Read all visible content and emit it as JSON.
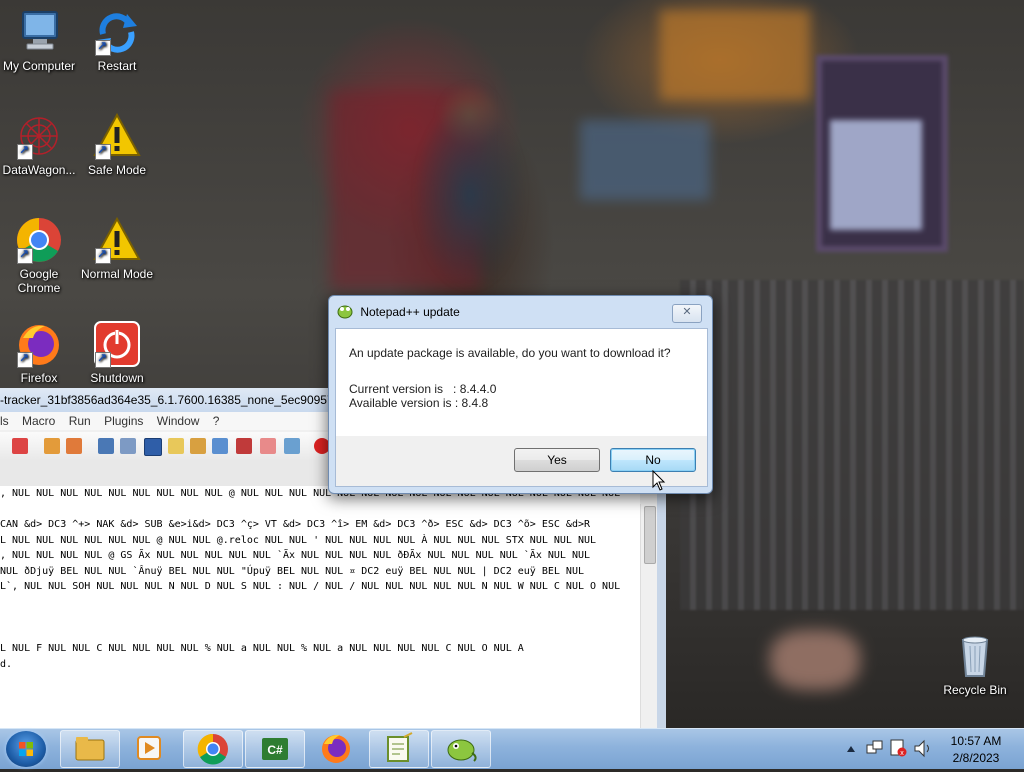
{
  "desktop": {
    "icons": [
      {
        "label": "My Computer"
      },
      {
        "label": "Restart"
      },
      {
        "label": "DataWagon..."
      },
      {
        "label": "Safe Mode"
      },
      {
        "label": "Google Chrome"
      },
      {
        "label": "Normal Mode"
      },
      {
        "label": "Firefox"
      },
      {
        "label": "Shutdown"
      },
      {
        "label": "Recycle Bin"
      }
    ]
  },
  "notepad": {
    "title": "-tracker_31bf3856ad364e35_6.1.7600.16385_none_5ec90957e1a8",
    "menu": [
      "ls",
      "Macro",
      "Run",
      "Plugins",
      "Window",
      "?"
    ],
    "editor_lines": [
      ", NUL NUL NUL NUL NUL NUL NUL NUL NUL @ NUL NUL NUL NUL NUL NUL NUL NUL NUL NUL NUL NUL NUL NUL NUL NUL",
      "",
      "CAN &d> DC3 ^+> NAK &d> SUB &e>i&d> DC3 ^ç> VT &d> DC3 ^î> EM &d> DC3 ^ð> ESC &d> DC3 ^õ> ESC &d>R",
      "L NUL NUL NUL NUL NUL NUL @ NUL NUL @.reloc NUL NUL ' NUL NUL NUL NUL À NUL NUL NUL STX NUL NUL NUL",
      ", NUL NUL NUL NUL @ GS Ãx NUL NUL NUL NUL NUL `Ãx NUL NUL NUL NUL ðÐÃx NUL NUL NUL NUL `Ãx NUL NUL",
      "  NUL ðDjuÿ BEL NUL NUL `Ânuÿ BEL NUL NUL \"Úpuÿ BEL NUL NUL ¤ DC2 euÿ BEL NUL NUL | DC2 euÿ BEL NUL",
      "L`, NUL NUL SOH NUL NUL NUL N NUL D NUL S NUL : NUL / NUL / NUL NUL NUL NUL NUL N NUL W NUL C NUL O NUL",
      "",
      "",
      "",
      "L NUL F NUL NUL C NUL NUL NUL   NUL % NUL a NUL   NUL % NUL a NUL   NUL NUL NUL C NUL O NUL A",
      "d."
    ]
  },
  "dialog": {
    "title": "Notepad++ update",
    "message": "An update package is available, do you want to download it?",
    "current_label": "Current version is",
    "current_value": ": 8.4.4.0",
    "available_label": "Available version is",
    "available_value": ": 8.4.8",
    "yes_label": "Yes",
    "no_label": "No",
    "close_glyph": "✕"
  },
  "taskbar": {
    "time": "10:57 AM",
    "date": "2/8/2023",
    "apps": [
      "explorer",
      "media-player",
      "chrome",
      "csharp-editor",
      "firefox",
      "notepad-plus-plus",
      "notepad-plus-plus-update"
    ]
  },
  "colors": {
    "taskbar": "#8db2dc",
    "dialog_frame": "#cfe0f4",
    "button_focus": "#bee6fd"
  }
}
